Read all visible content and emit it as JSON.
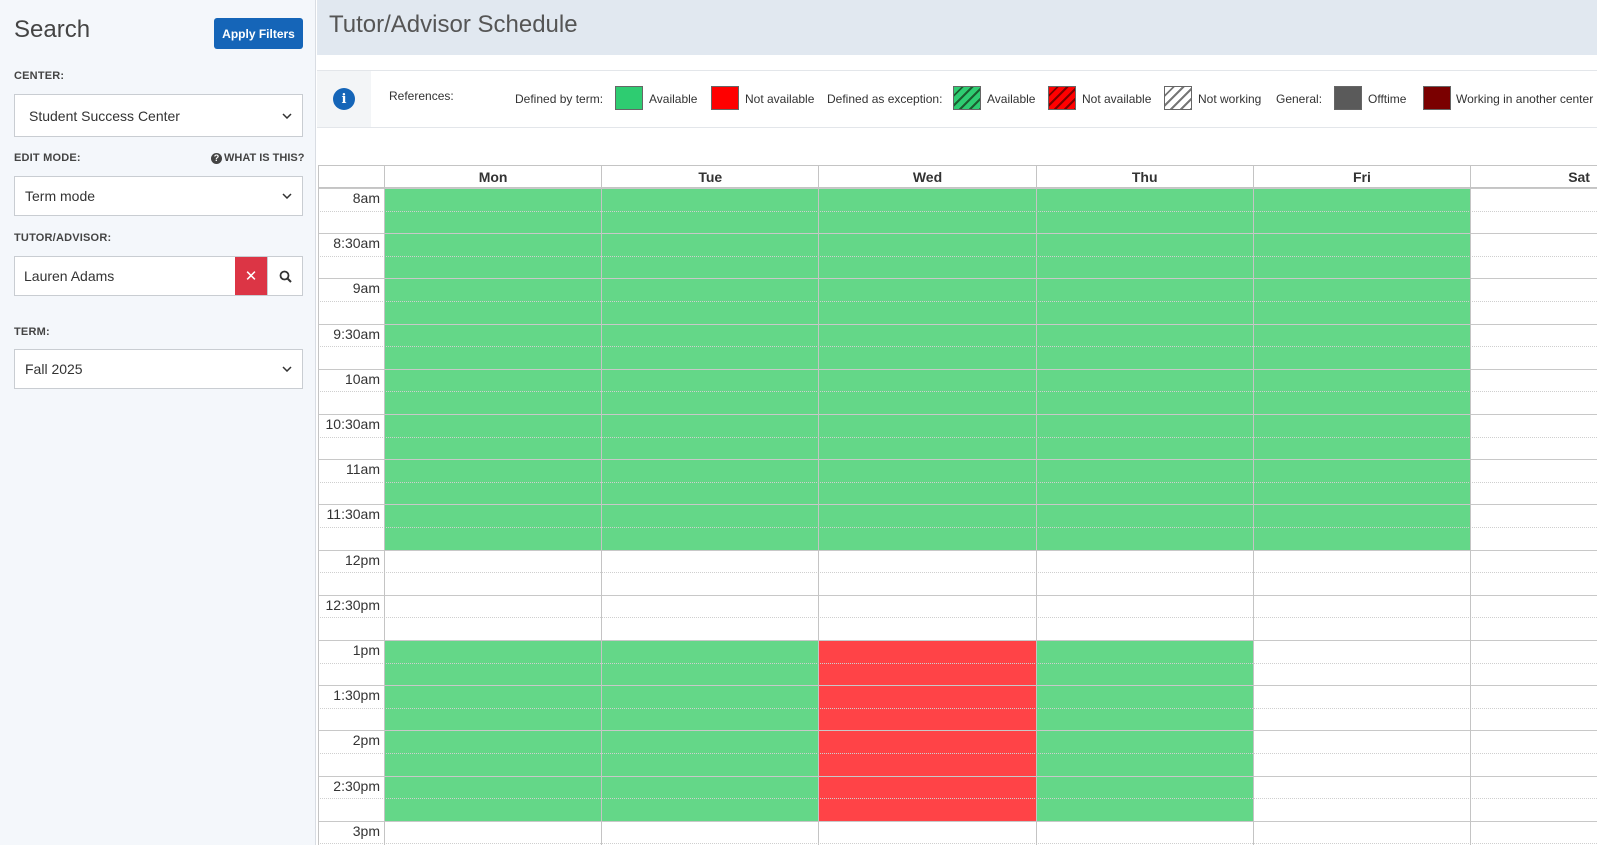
{
  "sidebar": {
    "title": "Search",
    "apply_label": "Apply Filters",
    "center_label": "CENTER:",
    "center_value": "Student Success Center",
    "edit_mode_label": "EDIT MODE:",
    "what_is_this": "WHAT IS THIS?",
    "edit_mode_value": "Term mode",
    "tutor_label": "TUTOR/ADVISOR:",
    "tutor_value": "Lauren Adams",
    "term_label": "TERM:",
    "term_value": "Fall 2025"
  },
  "header": {
    "title": "Tutor/Advisor Schedule"
  },
  "legend": {
    "references": "References:",
    "defined_by_term": "Defined by term:",
    "available": "Available",
    "not_available": "Not available",
    "defined_as_exception": "Defined as exception:",
    "not_working": "Not working",
    "general": "General:",
    "offtime": "Offtime",
    "working_other": "Working in another center",
    "colors": {
      "available": "#2ecc71",
      "not_available": "#ff0000",
      "offtime": "#5a5a5a",
      "working_other": "#7a0000"
    }
  },
  "calendar": {
    "days": [
      "Mon",
      "Tue",
      "Wed",
      "Thu",
      "Fri",
      "Sat"
    ],
    "times": [
      "8am",
      "8:30am",
      "9am",
      "9:30am",
      "10am",
      "10:30am",
      "11am",
      "11:30am",
      "12pm",
      "12:30pm",
      "1pm",
      "1:30pm",
      "2pm",
      "2:30pm",
      "3pm"
    ],
    "blocks": [
      {
        "day": "Mon",
        "start": "8am",
        "end": "12pm",
        "status": "available"
      },
      {
        "day": "Tue",
        "start": "8am",
        "end": "12pm",
        "status": "available"
      },
      {
        "day": "Wed",
        "start": "8am",
        "end": "12pm",
        "status": "available"
      },
      {
        "day": "Thu",
        "start": "8am",
        "end": "12pm",
        "status": "available"
      },
      {
        "day": "Fri",
        "start": "8am",
        "end": "12pm",
        "status": "available"
      },
      {
        "day": "Mon",
        "start": "1pm",
        "end": "3pm",
        "status": "available"
      },
      {
        "day": "Tue",
        "start": "1pm",
        "end": "3pm",
        "status": "available"
      },
      {
        "day": "Wed",
        "start": "1pm",
        "end": "3pm",
        "status": "not_available"
      },
      {
        "day": "Thu",
        "start": "1pm",
        "end": "3pm",
        "status": "available"
      }
    ]
  }
}
